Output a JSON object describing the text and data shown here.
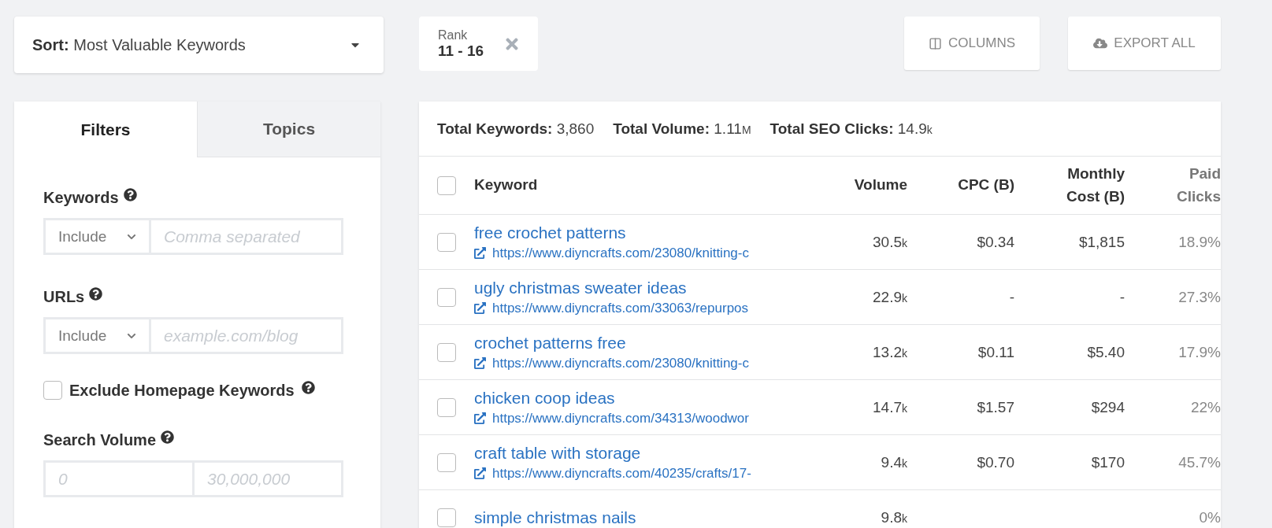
{
  "sort": {
    "label": "Sort:",
    "value": "Most Valuable Keywords"
  },
  "rank_filter": {
    "label": "Rank",
    "value": "11 - 16"
  },
  "actions": [
    {
      "kind": "columns",
      "label": "COLUMNS"
    },
    {
      "kind": "export",
      "label": "EXPORT ALL"
    }
  ],
  "tabs": [
    {
      "label": "Filters",
      "selected": true
    },
    {
      "label": "Topics",
      "selected": false
    }
  ],
  "filters": [
    {
      "kind": "text",
      "label": "Keywords",
      "mode": "Include",
      "placeholder": "Comma separated"
    },
    {
      "kind": "text",
      "label": "URLs",
      "mode": "Include",
      "placeholder": "example.com/blog"
    },
    {
      "kind": "checkbox",
      "label": "Exclude Homepage Keywords",
      "checked": false
    },
    {
      "kind": "range",
      "label": "Search Volume",
      "min_placeholder": "0",
      "max_placeholder": "30,000,000"
    }
  ],
  "summary": [
    {
      "label": "Total Keywords:",
      "value": "3,860"
    },
    {
      "label": "Total Volume:",
      "value": "1.11",
      "unit": "M"
    },
    {
      "label": "Total SEO Clicks:",
      "value": "14.9",
      "unit": "k"
    }
  ],
  "table": {
    "columns": [
      "Keyword",
      "Volume",
      "CPC (B)",
      "Monthly Cost (B)",
      "Paid Clicks"
    ],
    "all_checked": false,
    "rows": [
      {
        "checked": false,
        "keyword": "free crochet patterns",
        "url": "https://www.diyncrafts.com/23080/knitting-c",
        "volume": "30.5",
        "unit": "k",
        "cpc": "$0.34",
        "cost": "$1,815",
        "paid": "18.9%"
      },
      {
        "checked": false,
        "keyword": "ugly christmas sweater ideas",
        "url": "https://www.diyncrafts.com/33063/repurpos",
        "volume": "22.9",
        "unit": "k",
        "cpc": "-",
        "cost": "-",
        "paid": "27.3%"
      },
      {
        "checked": false,
        "keyword": "crochet patterns free",
        "url": "https://www.diyncrafts.com/23080/knitting-c",
        "volume": "13.2",
        "unit": "k",
        "cpc": "$0.11",
        "cost": "$5.40",
        "paid": "17.9%"
      },
      {
        "checked": false,
        "keyword": "chicken coop ideas",
        "url": "https://www.diyncrafts.com/34313/woodwor",
        "volume": "14.7",
        "unit": "k",
        "cpc": "$1.57",
        "cost": "$294",
        "paid": "22%"
      },
      {
        "checked": false,
        "keyword": "craft table with storage",
        "url": "https://www.diyncrafts.com/40235/crafts/17-",
        "volume": "9.4",
        "unit": "k",
        "cpc": "$0.70",
        "cost": "$170",
        "paid": "45.7%"
      },
      {
        "checked": false,
        "keyword": "simple christmas nails",
        "volume": "9.8",
        "unit": "k",
        "paid": "0%"
      }
    ]
  }
}
